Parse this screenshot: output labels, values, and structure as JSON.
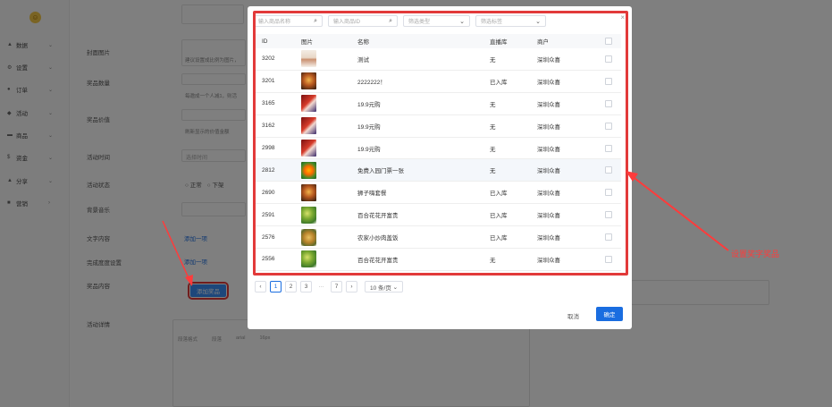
{
  "sidebar": {
    "logo_glyph": "☺",
    "items": [
      {
        "icon": "chart-icon",
        "glyph": "▲",
        "label": "数据",
        "chevron": "⌄"
      },
      {
        "icon": "gear-icon",
        "glyph": "⚙",
        "label": "设置",
        "chevron": "⌄"
      },
      {
        "icon": "order-icon",
        "glyph": "●",
        "label": "订单",
        "chevron": "⌄"
      },
      {
        "icon": "activity-icon",
        "glyph": "◆",
        "label": "活动",
        "chevron": "⌄"
      },
      {
        "icon": "goods-icon",
        "glyph": "▬",
        "label": "商品",
        "chevron": "⌄"
      },
      {
        "icon": "money-icon",
        "glyph": "$",
        "label": "资金",
        "chevron": "⌄"
      },
      {
        "icon": "share-icon",
        "glyph": "▲",
        "label": "分享",
        "chevron": "⌄"
      },
      {
        "icon": "marketing-icon",
        "glyph": "■",
        "label": "营销",
        "chevron": "›"
      }
    ]
  },
  "form": {
    "cover_label": "封面图片",
    "cover_hint": "建议设置成比例为图片，",
    "prize_count_label": "奖品数量",
    "prize_count_hint": "每邀成一个人减1，则活",
    "prize_value_label": "奖品价值",
    "prize_value_hint": "刷新显示的价值金额",
    "activity_time_label": "活动时间",
    "activity_time_placeholder": "选择时间",
    "activity_status_label": "活动状态",
    "status_normal": "正常",
    "status_offline": "下架",
    "background_label": "背景音乐",
    "text_content_label": "文字内容",
    "add_item": "添加一项",
    "progress_label": "完成度度设置",
    "prize_content_label": "奖品内容",
    "add_prize_button": "添加奖品",
    "details_label": "活动详情",
    "editor_font_family": "arial",
    "editor_font_size": "16px",
    "editor_paragraph": "段落格式",
    "editor_format": "段落"
  },
  "dialog": {
    "filters": [
      {
        "placeholder": "输入商品名称",
        "icon": "search-icon",
        "glyph": "⌕"
      },
      {
        "placeholder": "输入商品ID",
        "icon": "search-icon",
        "glyph": "⌕"
      },
      {
        "placeholder": "筛选类型",
        "icon": "chevron-down-icon",
        "glyph": "⌄"
      },
      {
        "placeholder": "筛选标签",
        "icon": "chevron-down-icon",
        "glyph": "⌄"
      }
    ],
    "columns": {
      "id": "ID",
      "image": "图片",
      "name": "名称",
      "stock": "直播库",
      "merchant": "商户"
    },
    "rows": [
      {
        "id": "3202",
        "name": "测试",
        "stock": "无",
        "merchant": "深圳众喜",
        "thumb": "person"
      },
      {
        "id": "3201",
        "name": "2222222！",
        "stock": "已入库",
        "merchant": "深圳众喜",
        "thumb": "food"
      },
      {
        "id": "3165",
        "name": "19.9元购",
        "stock": "无",
        "merchant": "深圳众喜",
        "thumb": "red"
      },
      {
        "id": "3162",
        "name": "19.9元购",
        "stock": "无",
        "merchant": "深圳众喜",
        "thumb": "red"
      },
      {
        "id": "2998",
        "name": "19.9元购",
        "stock": "无",
        "merchant": "深圳众喜",
        "thumb": "red"
      },
      {
        "id": "2812",
        "name": "免费入园门票一张",
        "stock": "无",
        "merchant": "深圳众喜",
        "thumb": "flower"
      },
      {
        "id": "2690",
        "name": "狮子嗨套餐",
        "stock": "已入库",
        "merchant": "深圳众喜",
        "thumb": "food"
      },
      {
        "id": "2591",
        "name": "百合花花开富贵",
        "stock": "已入库",
        "merchant": "深圳众喜",
        "thumb": "plant"
      },
      {
        "id": "2576",
        "name": "农家小炒肉盖饭",
        "stock": "已入库",
        "merchant": "深圳众喜",
        "thumb": "dish"
      },
      {
        "id": "2556",
        "name": "百合花花开富贵",
        "stock": "无",
        "merchant": "深圳众喜",
        "thumb": "plant"
      }
    ],
    "pagination": {
      "prev": "‹",
      "pages": [
        "1",
        "2",
        "3"
      ],
      "ellipsis": "···",
      "last": "7",
      "next": "›",
      "page_size": "10 条/页"
    },
    "cancel": "取消",
    "confirm": "确定",
    "close_glyph": "×"
  },
  "annotation": "设置奖字奖品",
  "colors": {
    "accent": "#1a6de0",
    "annotation": "#e23a3a",
    "overlay": "rgba(0,0,0,0.5)"
  }
}
